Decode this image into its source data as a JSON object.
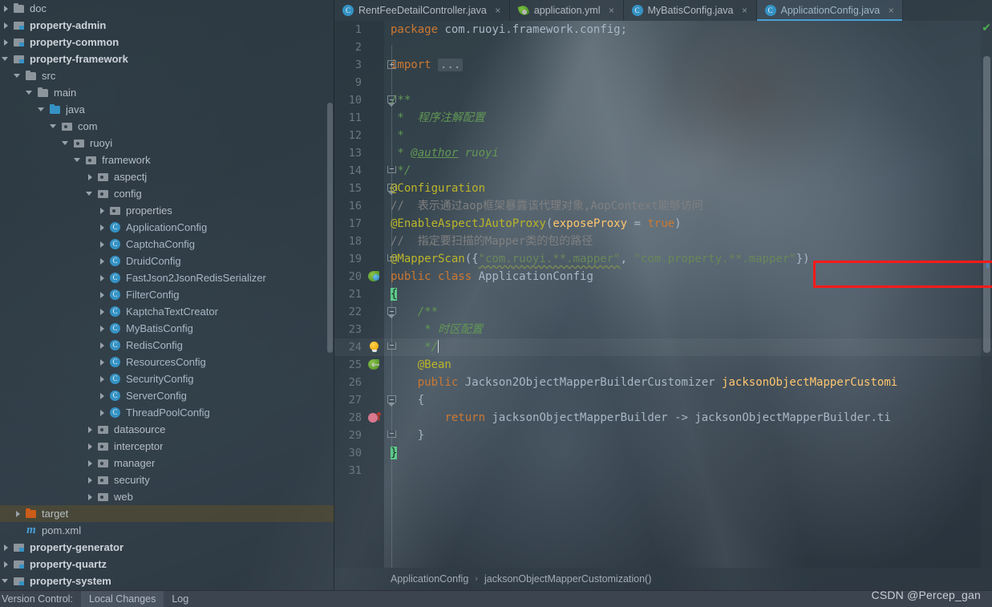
{
  "sidebar": {
    "name": "project-tree",
    "items": [
      {
        "label": "doc",
        "indent": 1,
        "arrow": "right",
        "icon": "folder",
        "bold": false,
        "selected": false
      },
      {
        "label": "property-admin",
        "indent": 1,
        "arrow": "right",
        "icon": "module",
        "bold": true,
        "selected": false
      },
      {
        "label": "property-common",
        "indent": 1,
        "arrow": "right",
        "icon": "module",
        "bold": true,
        "selected": false
      },
      {
        "label": "property-framework",
        "indent": 1,
        "arrow": "down",
        "icon": "module",
        "bold": true,
        "selected": false
      },
      {
        "label": "src",
        "indent": 2,
        "arrow": "down",
        "icon": "folder",
        "bold": false,
        "selected": false
      },
      {
        "label": "main",
        "indent": 3,
        "arrow": "down",
        "icon": "folder",
        "bold": false,
        "selected": false
      },
      {
        "label": "java",
        "indent": 4,
        "arrow": "down",
        "icon": "srcfolder",
        "bold": false,
        "selected": false
      },
      {
        "label": "com",
        "indent": 5,
        "arrow": "down",
        "icon": "pkg",
        "bold": false,
        "selected": false
      },
      {
        "label": "ruoyi",
        "indent": 6,
        "arrow": "down",
        "icon": "pkg",
        "bold": false,
        "selected": false
      },
      {
        "label": "framework",
        "indent": 7,
        "arrow": "down",
        "icon": "pkg",
        "bold": false,
        "selected": false
      },
      {
        "label": "aspectj",
        "indent": 8,
        "arrow": "right",
        "icon": "pkg",
        "bold": false,
        "selected": false
      },
      {
        "label": "config",
        "indent": 8,
        "arrow": "down",
        "icon": "pkg",
        "bold": false,
        "selected": false
      },
      {
        "label": "properties",
        "indent": 9,
        "arrow": "right",
        "icon": "pkg",
        "bold": false,
        "selected": false
      },
      {
        "label": "ApplicationConfig",
        "indent": 9,
        "arrow": "right",
        "icon": "class",
        "bold": false,
        "selected": false
      },
      {
        "label": "CaptchaConfig",
        "indent": 9,
        "arrow": "right",
        "icon": "class",
        "bold": false,
        "selected": false
      },
      {
        "label": "DruidConfig",
        "indent": 9,
        "arrow": "right",
        "icon": "class",
        "bold": false,
        "selected": false
      },
      {
        "label": "FastJson2JsonRedisSerializer",
        "indent": 9,
        "arrow": "right",
        "icon": "class",
        "bold": false,
        "selected": false
      },
      {
        "label": "FilterConfig",
        "indent": 9,
        "arrow": "right",
        "icon": "class",
        "bold": false,
        "selected": false
      },
      {
        "label": "KaptchaTextCreator",
        "indent": 9,
        "arrow": "right",
        "icon": "class",
        "bold": false,
        "selected": false
      },
      {
        "label": "MyBatisConfig",
        "indent": 9,
        "arrow": "right",
        "icon": "class",
        "bold": false,
        "selected": false
      },
      {
        "label": "RedisConfig",
        "indent": 9,
        "arrow": "right",
        "icon": "class",
        "bold": false,
        "selected": false
      },
      {
        "label": "ResourcesConfig",
        "indent": 9,
        "arrow": "right",
        "icon": "class",
        "bold": false,
        "selected": false
      },
      {
        "label": "SecurityConfig",
        "indent": 9,
        "arrow": "right",
        "icon": "class",
        "bold": false,
        "selected": false
      },
      {
        "label": "ServerConfig",
        "indent": 9,
        "arrow": "right",
        "icon": "class",
        "bold": false,
        "selected": false
      },
      {
        "label": "ThreadPoolConfig",
        "indent": 9,
        "arrow": "right",
        "icon": "class",
        "bold": false,
        "selected": false
      },
      {
        "label": "datasource",
        "indent": 8,
        "arrow": "right",
        "icon": "pkg",
        "bold": false,
        "selected": false
      },
      {
        "label": "interceptor",
        "indent": 8,
        "arrow": "right",
        "icon": "pkg",
        "bold": false,
        "selected": false
      },
      {
        "label": "manager",
        "indent": 8,
        "arrow": "right",
        "icon": "pkg",
        "bold": false,
        "selected": false
      },
      {
        "label": "security",
        "indent": 8,
        "arrow": "right",
        "icon": "pkg",
        "bold": false,
        "selected": false
      },
      {
        "label": "web",
        "indent": 8,
        "arrow": "right",
        "icon": "pkg",
        "bold": false,
        "selected": false
      },
      {
        "label": "target",
        "indent": 2,
        "arrow": "right",
        "icon": "target",
        "bold": false,
        "selected": true
      },
      {
        "label": "pom.xml",
        "indent": 2,
        "arrow": "none",
        "icon": "maven",
        "bold": false,
        "selected": false
      },
      {
        "label": "property-generator",
        "indent": 1,
        "arrow": "right",
        "icon": "module",
        "bold": true,
        "selected": false
      },
      {
        "label": "property-quartz",
        "indent": 1,
        "arrow": "right",
        "icon": "module",
        "bold": true,
        "selected": false
      },
      {
        "label": "property-system",
        "indent": 1,
        "arrow": "down",
        "icon": "module",
        "bold": true,
        "selected": false
      }
    ]
  },
  "tabs": [
    {
      "label": "RentFeeDetailController.java",
      "icon": "class-icon",
      "active": false,
      "close": "×"
    },
    {
      "label": "application.yml",
      "icon": "yaml-icon",
      "active": false,
      "close": "×"
    },
    {
      "label": "MyBatisConfig.java",
      "icon": "class-icon",
      "active": false,
      "close": "×"
    },
    {
      "label": "ApplicationConfig.java",
      "icon": "class-icon",
      "active": true,
      "close": "×"
    }
  ],
  "editor": {
    "file": "ApplicationConfig.java",
    "highlighted_line": 24,
    "lines": [
      {
        "n": "1",
        "gutter": "",
        "fold": "",
        "html": "<span class=\"kw\">package</span> <span class=\"pkgname\">com.ruoyi.framework.config</span><span class=\"id\">;</span>"
      },
      {
        "n": "2",
        "gutter": "",
        "fold": "",
        "html": ""
      },
      {
        "n": "3",
        "gutter": "",
        "fold": "plus",
        "html": "<span class=\"kw\">import</span> <span class=\"fold-ph\">...</span>"
      },
      {
        "n": "9",
        "gutter": "",
        "fold": "",
        "html": ""
      },
      {
        "n": "10",
        "gutter": "",
        "fold": "tri",
        "html": "<span class=\"doc\">/**</span>"
      },
      {
        "n": "11",
        "gutter": "",
        "fold": "",
        "html": "<span class=\"doc\"> *  程序注解配置</span>"
      },
      {
        "n": "12",
        "gutter": "",
        "fold": "",
        "html": "<span class=\"doc\"> *</span>"
      },
      {
        "n": "13",
        "gutter": "",
        "fold": "",
        "html": "<span class=\"doc\"> * </span><span class=\"doc\" style=\"text-decoration:underline\">@author</span><span class=\"doc\"> ruoyi</span>"
      },
      {
        "n": "14",
        "gutter": "",
        "fold": "up",
        "html": "<span class=\"doc\"> */</span>"
      },
      {
        "n": "15",
        "gutter": "",
        "fold": "tri",
        "html": "<span class=\"anno\">@Configuration</span>"
      },
      {
        "n": "16",
        "gutter": "",
        "fold": "",
        "html": "<span class=\"cmt\">//  表示通过aop框架暴露该代理对象,AopContext能够访问</span>"
      },
      {
        "n": "17",
        "gutter": "",
        "fold": "",
        "html": "<span class=\"anno\">@EnableAspectJAutoProxy</span><span class=\"id\">(</span><span class=\"fld\">exposeProxy</span> <span class=\"id\">=</span> <span class=\"kw\">true</span><span class=\"id\">)</span>"
      },
      {
        "n": "18",
        "gutter": "",
        "fold": "",
        "html": "<span class=\"cmt\">//  指定要扫描的Mapper类的包的路径</span>"
      },
      {
        "n": "19",
        "gutter": "",
        "fold": "up",
        "html": "<span class=\"anno\">@MapperScan</span><span class=\"id\">({</span><span class=\"str squiggle\">\"com.ruoyi.**.mapper\"</span><span class=\"id\">, </span><span class=\"str\">\"com.property.**.mapper\"</span><span class=\"id\">})</span>"
      },
      {
        "n": "20",
        "gutter": "bean",
        "fold": "",
        "html": "<span class=\"kw\">public</span> <span class=\"kw\">class</span> <span class=\"typ\">ApplicationConfig</span>"
      },
      {
        "n": "21",
        "gutter": "",
        "fold": "",
        "html": "<span class=\"brace-hl\">{</span>"
      },
      {
        "n": "22",
        "gutter": "",
        "fold": "tri",
        "html": "    <span class=\"doc\">/**</span>"
      },
      {
        "n": "23",
        "gutter": "",
        "fold": "",
        "html": "     <span class=\"doc\">* 时区配置</span>"
      },
      {
        "n": "24",
        "gutter": "bulb",
        "fold": "up",
        "html": "     <span class=\"doc\">*/</span><span class=\"caret\"></span>"
      },
      {
        "n": "25",
        "gutter": "beanback",
        "fold": "",
        "html": "    <span class=\"anno\">@Bean</span>"
      },
      {
        "n": "26",
        "gutter": "",
        "fold": "",
        "html": "    <span class=\"kw\">public</span> <span class=\"typ\">Jackson2ObjectMapperBuilderCustomizer</span> <span class=\"fld\">jacksonObjectMapperCustomi</span>"
      },
      {
        "n": "27",
        "gutter": "",
        "fold": "tri",
        "html": "    <span class=\"id\">{</span>"
      },
      {
        "n": "28",
        "gutter": "override",
        "fold": "",
        "html": "        <span class=\"kw\">return</span> <span class=\"id\">jacksonObjectMapperBuilder -&gt; jacksonObjectMapperBuilder.ti</span>"
      },
      {
        "n": "29",
        "gutter": "",
        "fold": "up",
        "html": "    <span class=\"id\">}</span>"
      },
      {
        "n": "30",
        "gutter": "",
        "fold": "",
        "html": "<span class=\"brace-hl\">}</span>"
      },
      {
        "n": "31",
        "gutter": "",
        "fold": "",
        "html": ""
      }
    ],
    "annotation_box": {
      "color": "#ff1a1a",
      "target_line": 19
    },
    "inspection_status": "✔"
  },
  "breadcrumb": {
    "class": "ApplicationConfig",
    "separator": "›",
    "member": "jacksonObjectMapperCustomization()"
  },
  "statusbar": {
    "vcs_label": "Version Control:",
    "local_changes": "Local Changes",
    "log": "Log"
  },
  "watermark": "CSDN @Percep_gan"
}
